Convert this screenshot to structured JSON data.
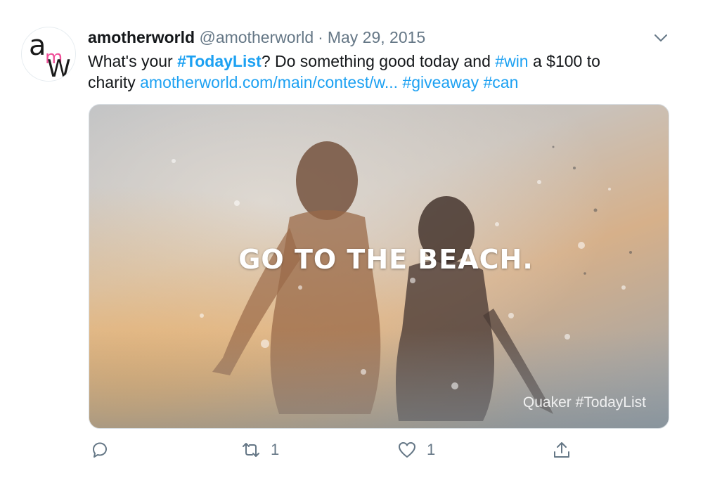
{
  "tweet": {
    "display_name": "amotherworld",
    "handle": "@amotherworld",
    "separator": "·",
    "date": "May 29, 2015",
    "text_parts": {
      "p1": "What's your ",
      "tag_todaylist": "#TodayList",
      "p2": "? Do something good today and ",
      "tag_win": "#win",
      "p3": " a $100 to charity ",
      "link": "amotherworld.com/main/contest/w...",
      "sp1": " ",
      "tag_giveaway": "#giveaway",
      "sp2": " ",
      "tag_can": "#can"
    }
  },
  "avatar": {
    "letters": [
      "a",
      "m",
      "W"
    ]
  },
  "media": {
    "caption": "GO TO THE BEACH.",
    "watermark": "Quaker #TodayList"
  },
  "actions": {
    "reply_icon": "reply-icon",
    "retweet_icon": "retweet-icon",
    "retweet_count": "1",
    "like_icon": "heart-icon",
    "like_count": "1",
    "share_icon": "share-icon"
  },
  "colors": {
    "link": "#1da1f2",
    "muted": "#657786",
    "text": "#14171a",
    "avatar_accent": "#f04e98"
  }
}
